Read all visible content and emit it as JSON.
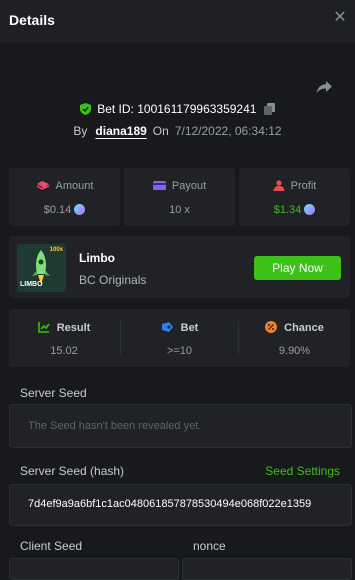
{
  "header": {
    "title": "Details"
  },
  "bet": {
    "id_label": "Bet ID:",
    "id": "100161179963359241",
    "by_label": "By",
    "user": "diana189",
    "on_label": "On",
    "date": "7/12/2022, 06:34:12"
  },
  "stats": {
    "amount": {
      "label": "Amount",
      "value": "$0.14"
    },
    "payout": {
      "label": "Payout",
      "value": "10 x"
    },
    "profit": {
      "label": "Profit",
      "value": "$1.34"
    }
  },
  "game": {
    "name": "Limbo",
    "provider": "BC Originals",
    "thumb_text": "LIMBO",
    "thumb_badge": "100x",
    "play_label": "Play Now"
  },
  "results": {
    "result": {
      "label": "Result",
      "value": "15.02"
    },
    "bet": {
      "label": "Bet",
      "value": ">=10"
    },
    "chance": {
      "label": "Chance",
      "value": "9.90%"
    }
  },
  "seeds": {
    "server_seed_label": "Server Seed",
    "server_seed_placeholder": "The Seed hasn't been revealed yet.",
    "server_hash_label": "Server Seed (hash)",
    "seed_settings_label": "Seed Settings",
    "server_hash_value": "7d4ef9a9a6bf1c1ac048061857878530494e068f022e1359",
    "client_seed_label": "Client Seed",
    "nonce_label": "nonce"
  },
  "colors": {
    "accent_green": "#3bc117",
    "background": "#18191d",
    "card": "#202226"
  }
}
